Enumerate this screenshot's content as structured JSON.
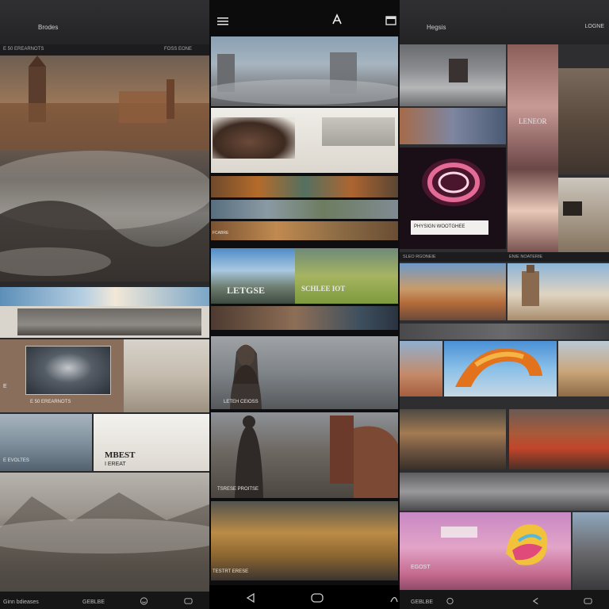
{
  "left": {
    "header": {
      "title": "Brodes"
    },
    "subbar": {
      "text": "E 50 EREARNOTS",
      "right_text": "FOSS EONE"
    },
    "captions": {
      "side_mark": "E"
    },
    "card_small_title": "E EVOLTES",
    "card_title": "MBEST",
    "card_subtitle": "I EREAT",
    "bottom_label": "Ginn bdieases"
  },
  "middle": {
    "caption_1": "FCABRE",
    "caption_2": "LETGSE",
    "caption_3": "SCHLEE IOT",
    "caption_4": "LETEH CEIOSS",
    "caption_5": "TSRESE PROITSE",
    "caption_6": "TESTRT ERESE",
    "nav_icons": [
      "back-icon",
      "home-icon",
      "recents-icon"
    ]
  },
  "right": {
    "header": {
      "title": "Hegsis",
      "right_text": "LOGNE"
    },
    "poster_title": "LENEOR",
    "search_label": "PHYSIGN WOOTGHEE",
    "tag_left": "SLEO RGONEIE",
    "tag_right": "ENIE NOATERIE",
    "thumb_caption": "EGOST",
    "bottom_label": "GEBLBE"
  }
}
